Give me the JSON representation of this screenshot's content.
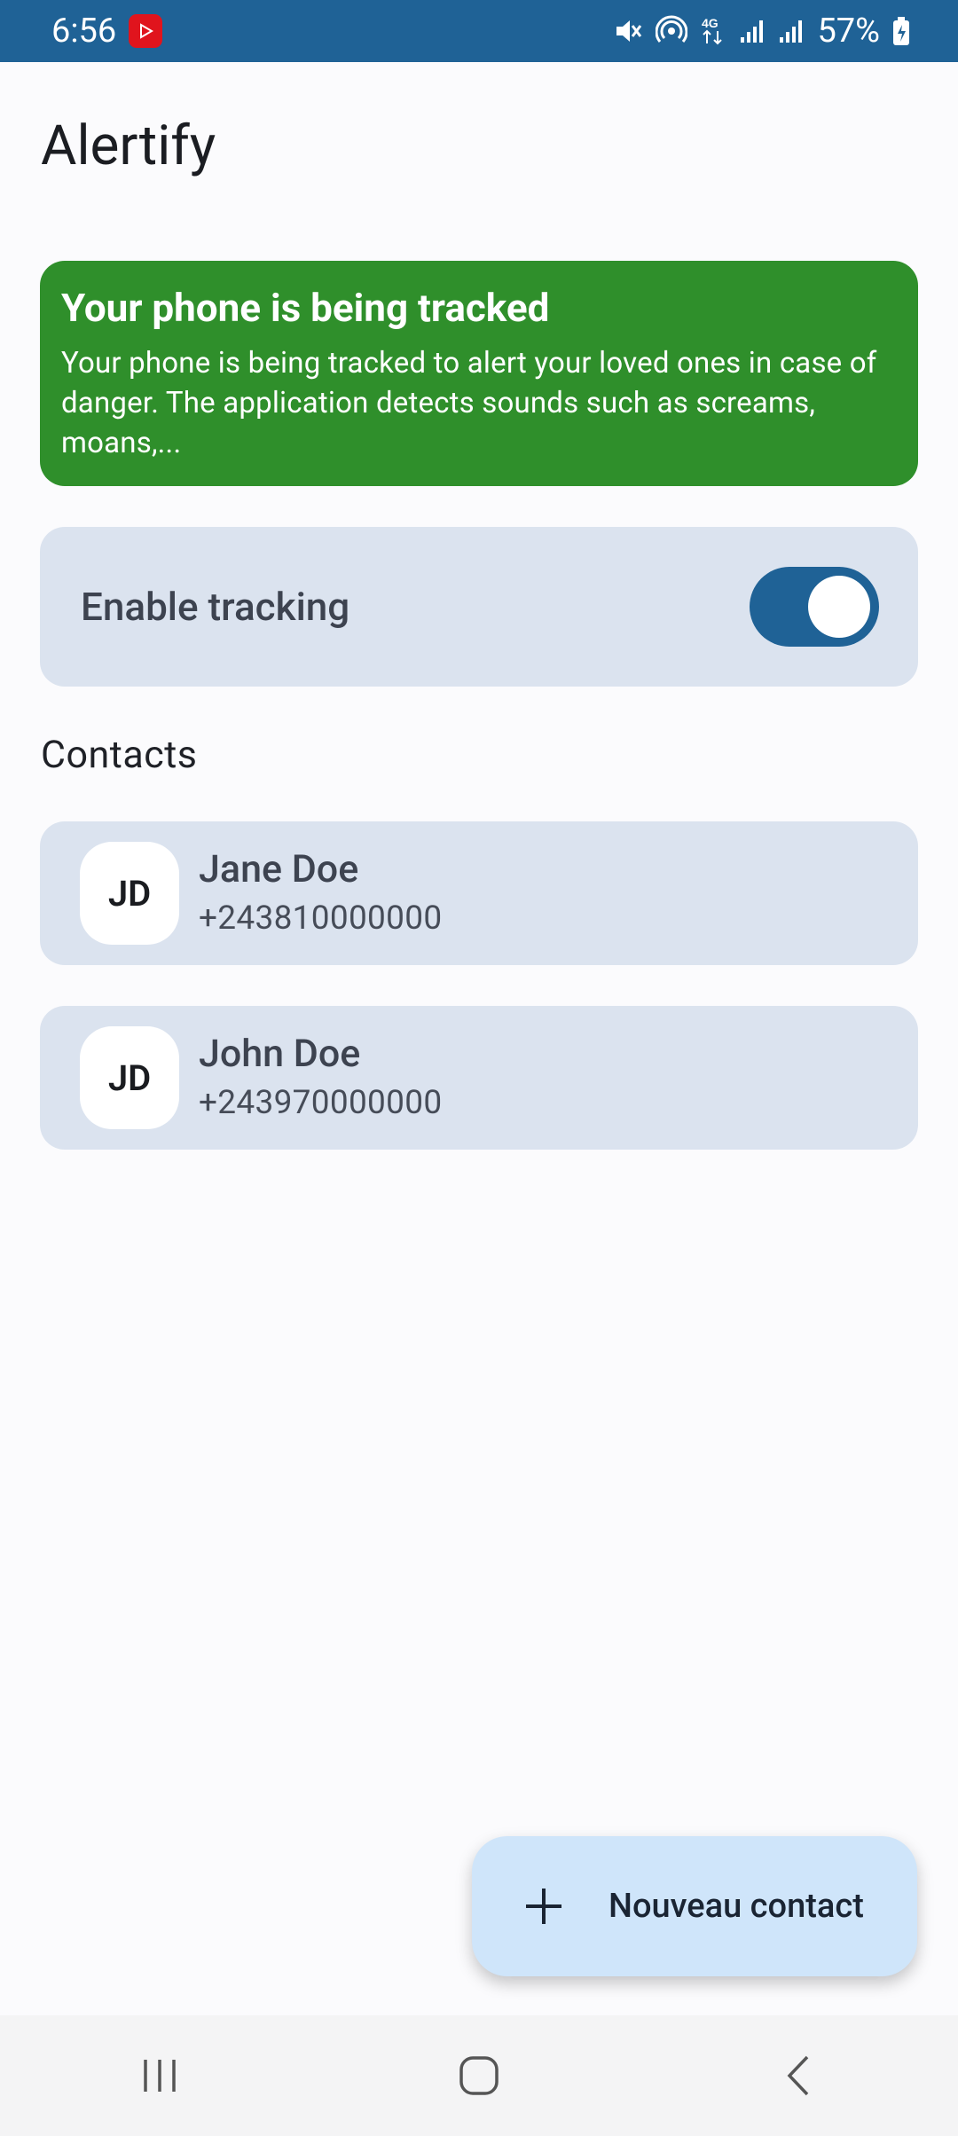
{
  "status_bar": {
    "time": "6:56",
    "battery": "57%",
    "icons": [
      "youtube-icon",
      "mute-icon",
      "hotspot-icon",
      "4g-icon",
      "signal-icon",
      "signal-icon",
      "battery-icon"
    ]
  },
  "app": {
    "title": "Alertify"
  },
  "banner": {
    "title": "Your phone is being tracked",
    "text": "Your phone is being tracked to alert your loved ones in case of danger. The application detects sounds such as screams, moans,...",
    "color": "#2f8f2b"
  },
  "tracking": {
    "label": "Enable tracking",
    "enabled": true,
    "accent": "#1f6296"
  },
  "contacts_section": {
    "label": "Contacts",
    "items": [
      {
        "initials": "JD",
        "name": "Jane Doe",
        "phone": "+243810000000"
      },
      {
        "initials": "JD",
        "name": "John Doe",
        "phone": "+243970000000"
      }
    ]
  },
  "fab": {
    "label": "Nouveau contact",
    "icon": "plus-icon"
  },
  "nav": {
    "icons": [
      "recent-apps-icon",
      "home-icon",
      "back-icon"
    ]
  }
}
